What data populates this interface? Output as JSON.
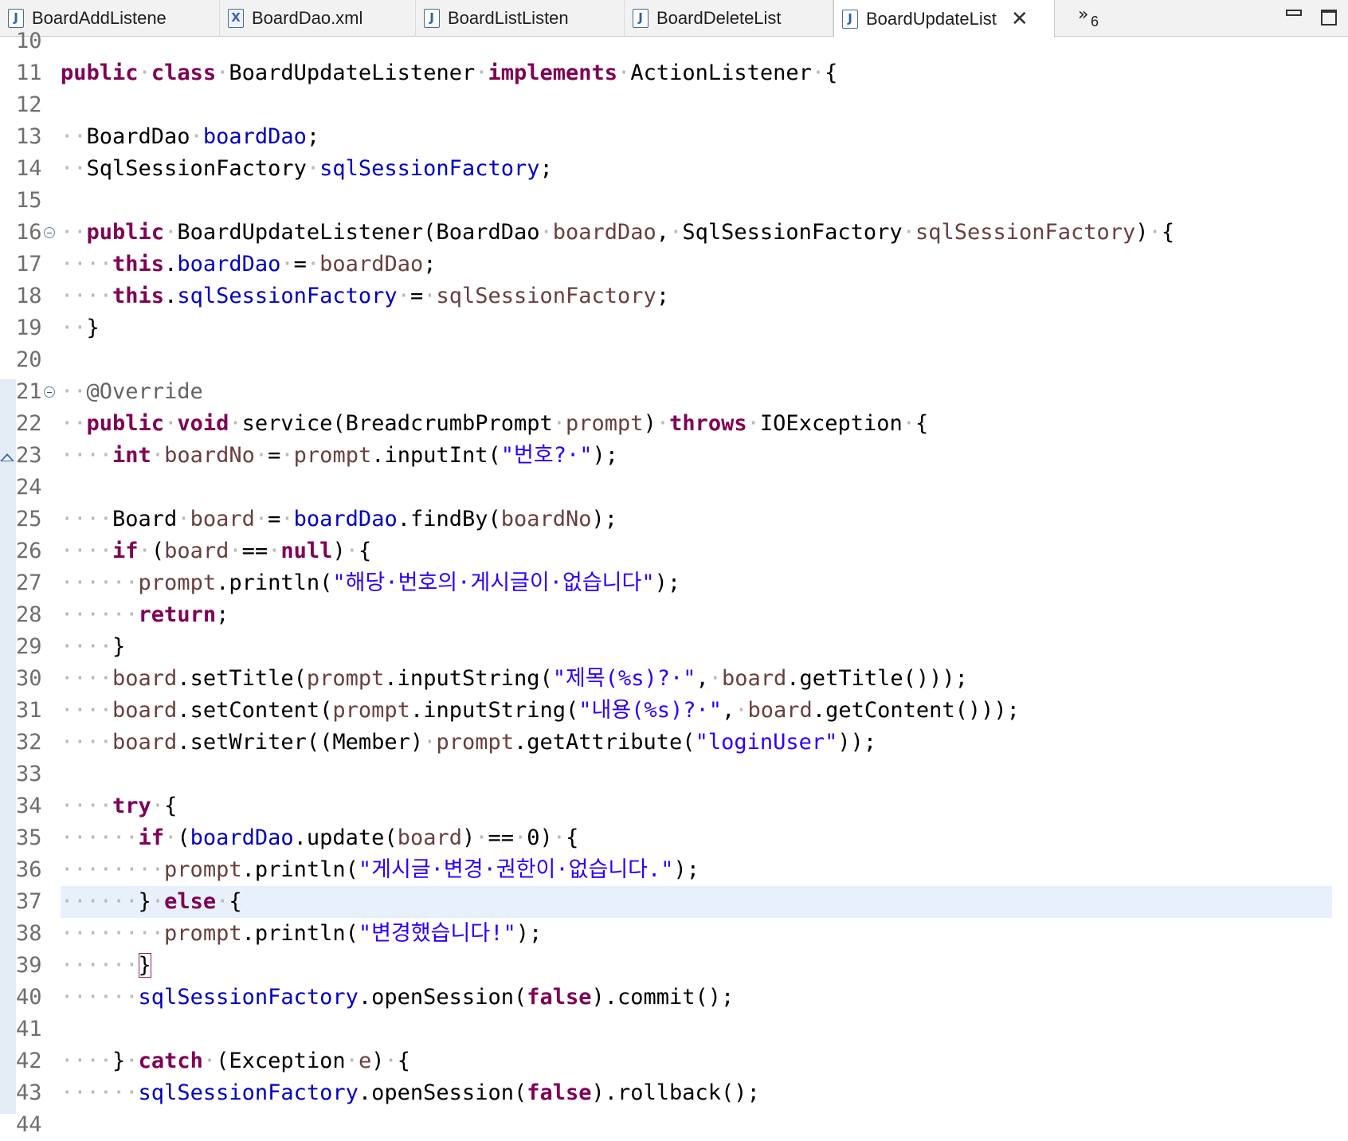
{
  "tabs": [
    {
      "label": "BoardAddListene",
      "icon": "java-file-icon",
      "active": false
    },
    {
      "label": "BoardDao.xml",
      "icon": "xml-file-icon",
      "active": false
    },
    {
      "label": "BoardListListen",
      "icon": "java-file-icon",
      "active": false
    },
    {
      "label": "BoardDeleteList",
      "icon": "java-file-icon",
      "active": false
    },
    {
      "label": "BoardUpdateList",
      "icon": "java-file-icon",
      "active": true
    }
  ],
  "overflow": {
    "chevron": "»",
    "count": "6"
  },
  "icons": {
    "java": "J",
    "xml": "X",
    "close": "✕"
  },
  "first_line": 10,
  "folded_lines": [
    16,
    21
  ],
  "current_line": 37,
  "lines": [
    [
      [
        "",
        "/*---*/"
      ]
    ],
    [
      [
        "kw",
        "public"
      ],
      [
        "ws",
        "·"
      ],
      [
        "kw",
        "class"
      ],
      [
        "ws",
        "·"
      ],
      [
        "",
        "BoardUpdateListener"
      ],
      [
        "ws",
        "·"
      ],
      [
        "kw",
        "implements"
      ],
      [
        "ws",
        "·"
      ],
      [
        "",
        "ActionListener"
      ],
      [
        "ws",
        "·"
      ],
      [
        "",
        "{"
      ]
    ],
    [],
    [
      [
        "ws",
        "··"
      ],
      [
        "",
        "BoardDao"
      ],
      [
        "ws",
        "·"
      ],
      [
        "fd",
        "boardDao"
      ],
      [
        "",
        ";"
      ]
    ],
    [
      [
        "ws",
        "··"
      ],
      [
        "",
        "SqlSessionFactory"
      ],
      [
        "ws",
        "·"
      ],
      [
        "fd",
        "sqlSessionFactory"
      ],
      [
        "",
        ";"
      ]
    ],
    [],
    [
      [
        "ws",
        "··"
      ],
      [
        "kw",
        "public"
      ],
      [
        "ws",
        "·"
      ],
      [
        "",
        "BoardUpdateListener(BoardDao"
      ],
      [
        "ws",
        "·"
      ],
      [
        "pm",
        "boardDao"
      ],
      [
        "",
        ","
      ],
      [
        "ws",
        "·"
      ],
      [
        "",
        "SqlSessionFactory"
      ],
      [
        "ws",
        "·"
      ],
      [
        "pm",
        "sqlSessionFactory"
      ],
      [
        "",
        ")"
      ],
      [
        "ws",
        "·"
      ],
      [
        "",
        "{"
      ]
    ],
    [
      [
        "ws",
        "····"
      ],
      [
        "kw",
        "this"
      ],
      [
        "",
        "."
      ],
      [
        "fd",
        "boardDao"
      ],
      [
        "ws",
        "·"
      ],
      [
        "",
        "="
      ],
      [
        "ws",
        "·"
      ],
      [
        "pm",
        "boardDao"
      ],
      [
        "",
        ";"
      ]
    ],
    [
      [
        "ws",
        "····"
      ],
      [
        "kw",
        "this"
      ],
      [
        "",
        "."
      ],
      [
        "fd",
        "sqlSessionFactory"
      ],
      [
        "ws",
        "·"
      ],
      [
        "",
        "="
      ],
      [
        "ws",
        "·"
      ],
      [
        "pm",
        "sqlSessionFactory"
      ],
      [
        "",
        ";"
      ]
    ],
    [
      [
        "ws",
        "··"
      ],
      [
        "",
        "}"
      ]
    ],
    [],
    [
      [
        "ws",
        "··"
      ],
      [
        "an",
        "@Override"
      ]
    ],
    [
      [
        "ws",
        "··"
      ],
      [
        "kw",
        "public"
      ],
      [
        "ws",
        "·"
      ],
      [
        "kw",
        "void"
      ],
      [
        "ws",
        "·"
      ],
      [
        "",
        "service(BreadcrumbPrompt"
      ],
      [
        "ws",
        "·"
      ],
      [
        "pm",
        "prompt"
      ],
      [
        "",
        ")"
      ],
      [
        "ws",
        "·"
      ],
      [
        "kw",
        "throws"
      ],
      [
        "ws",
        "·"
      ],
      [
        "",
        "IOException"
      ],
      [
        "ws",
        "·"
      ],
      [
        "",
        "{"
      ]
    ],
    [
      [
        "ws",
        "····"
      ],
      [
        "kw",
        "int"
      ],
      [
        "ws",
        "·"
      ],
      [
        "pm",
        "boardNo"
      ],
      [
        "ws",
        "·"
      ],
      [
        "",
        "="
      ],
      [
        "ws",
        "·"
      ],
      [
        "pm",
        "prompt"
      ],
      [
        "",
        ".inputInt("
      ],
      [
        "st",
        "\"번호?·\""
      ],
      [
        "",
        ");"
      ]
    ],
    [],
    [
      [
        "ws",
        "····"
      ],
      [
        "",
        "Board"
      ],
      [
        "ws",
        "·"
      ],
      [
        "pm",
        "board"
      ],
      [
        "ws",
        "·"
      ],
      [
        "",
        "="
      ],
      [
        "ws",
        "·"
      ],
      [
        "fd",
        "boardDao"
      ],
      [
        "",
        ".findBy("
      ],
      [
        "pm",
        "boardNo"
      ],
      [
        "",
        ");"
      ]
    ],
    [
      [
        "ws",
        "····"
      ],
      [
        "kw",
        "if"
      ],
      [
        "ws",
        "·"
      ],
      [
        "",
        "("
      ],
      [
        "pm",
        "board"
      ],
      [
        "ws",
        "·"
      ],
      [
        "",
        "=="
      ],
      [
        "ws",
        "·"
      ],
      [
        "kw",
        "null"
      ],
      [
        "",
        ")"
      ],
      [
        "ws",
        "·"
      ],
      [
        "",
        "{"
      ]
    ],
    [
      [
        "ws",
        "······"
      ],
      [
        "pm",
        "prompt"
      ],
      [
        "",
        ".println("
      ],
      [
        "st",
        "\"해당·번호의·게시글이·없습니다\""
      ],
      [
        "",
        ");"
      ]
    ],
    [
      [
        "ws",
        "······"
      ],
      [
        "kw",
        "return"
      ],
      [
        "",
        ";"
      ]
    ],
    [
      [
        "ws",
        "····"
      ],
      [
        "",
        "}"
      ]
    ],
    [
      [
        "ws",
        "····"
      ],
      [
        "pm",
        "board"
      ],
      [
        "",
        ".setTitle("
      ],
      [
        "pm",
        "prompt"
      ],
      [
        "",
        ".inputString("
      ],
      [
        "st",
        "\"제목(%s)?·\""
      ],
      [
        "",
        ","
      ],
      [
        "ws",
        "·"
      ],
      [
        "pm",
        "board"
      ],
      [
        "",
        ".getTitle()));"
      ]
    ],
    [
      [
        "ws",
        "····"
      ],
      [
        "pm",
        "board"
      ],
      [
        "",
        ".setContent("
      ],
      [
        "pm",
        "prompt"
      ],
      [
        "",
        ".inputString("
      ],
      [
        "st",
        "\"내용(%s)?·\""
      ],
      [
        "",
        ","
      ],
      [
        "ws",
        "·"
      ],
      [
        "pm",
        "board"
      ],
      [
        "",
        ".getContent()));"
      ]
    ],
    [
      [
        "ws",
        "····"
      ],
      [
        "pm",
        "board"
      ],
      [
        "",
        ".setWriter((Member)"
      ],
      [
        "ws",
        "·"
      ],
      [
        "pm",
        "prompt"
      ],
      [
        "",
        ".getAttribute("
      ],
      [
        "st",
        "\"loginUser\""
      ],
      [
        "",
        "));"
      ]
    ],
    [],
    [
      [
        "ws",
        "····"
      ],
      [
        "kw",
        "try"
      ],
      [
        "ws",
        "·"
      ],
      [
        "",
        "{"
      ]
    ],
    [
      [
        "ws",
        "······"
      ],
      [
        "kw",
        "if"
      ],
      [
        "ws",
        "·"
      ],
      [
        "",
        "("
      ],
      [
        "fd",
        "boardDao"
      ],
      [
        "",
        ".update("
      ],
      [
        "pm",
        "board"
      ],
      [
        "",
        ")"
      ],
      [
        "ws",
        "·"
      ],
      [
        "",
        "=="
      ],
      [
        "ws",
        "·"
      ],
      [
        "",
        "0)"
      ],
      [
        "ws",
        "·"
      ],
      [
        "",
        "{"
      ]
    ],
    [
      [
        "ws",
        "········"
      ],
      [
        "pm",
        "prompt"
      ],
      [
        "",
        ".println("
      ],
      [
        "st",
        "\"게시글·변경·권한이·없습니다.\""
      ],
      [
        "",
        ");"
      ]
    ],
    [
      [
        "ws",
        "······"
      ],
      [
        "",
        "}"
      ],
      [
        "ws",
        "·"
      ],
      [
        "kw",
        "else"
      ],
      [
        "ws",
        "·"
      ],
      [
        "",
        "{"
      ]
    ],
    [
      [
        "ws",
        "········"
      ],
      [
        "pm",
        "prompt"
      ],
      [
        "",
        ".println("
      ],
      [
        "st",
        "\"변경했습니다!\""
      ],
      [
        "",
        ");"
      ]
    ],
    [
      [
        "ws",
        "······"
      ],
      [
        "br",
        "}"
      ]
    ],
    [
      [
        "ws",
        "······"
      ],
      [
        "fd",
        "sqlSessionFactory"
      ],
      [
        "",
        ".openSession("
      ],
      [
        "kw",
        "false"
      ],
      [
        "",
        ").commit();"
      ]
    ],
    [],
    [
      [
        "ws",
        "····"
      ],
      [
        "",
        "}"
      ],
      [
        "ws",
        "·"
      ],
      [
        "kw",
        "catch"
      ],
      [
        "ws",
        "·"
      ],
      [
        "",
        "(Exception"
      ],
      [
        "ws",
        "·"
      ],
      [
        "pm",
        "e"
      ],
      [
        "",
        ")"
      ],
      [
        "ws",
        "·"
      ],
      [
        "",
        "{"
      ]
    ],
    [
      [
        "ws",
        "······"
      ],
      [
        "fd",
        "sqlSessionFactory"
      ],
      [
        "",
        ".openSession("
      ],
      [
        "kw",
        "false"
      ],
      [
        "",
        ").rollback();"
      ]
    ],
    []
  ]
}
